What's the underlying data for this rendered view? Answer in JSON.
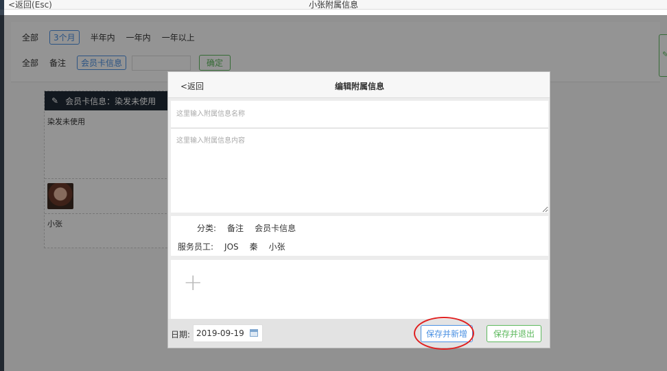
{
  "topbar": {
    "back_label": "<返回(Esc)",
    "title": "小张附属信息"
  },
  "filters": {
    "row1": [
      "全部",
      "3个月",
      "半年内",
      "一年内",
      "一年以上"
    ],
    "row2": [
      "全部",
      "备注",
      "会员卡信息"
    ],
    "confirm_label": "确定"
  },
  "card": {
    "header": "会员卡信息：染发未使用",
    "body": "染发未使用",
    "name": "小张"
  },
  "modal": {
    "back_label": "<返回",
    "title": "编辑附属信息",
    "name_placeholder": "这里输入附属信息名称",
    "content_placeholder": "这里输入附属信息内容",
    "category_label": "分类:",
    "categories": [
      "备注",
      "会员卡信息"
    ],
    "staff_label": "服务员工:",
    "staff": [
      "JOS",
      "秦",
      "小张"
    ],
    "add_icon": "+",
    "date_label": "日期:",
    "date_value": "2019-09-19",
    "save_new_label": "保存并新增",
    "save_exit_label": "保存并退出"
  },
  "colors": {
    "accent_blue": "#4a90e2",
    "accent_green": "#5cb85c",
    "highlight_red": "#e02020"
  }
}
